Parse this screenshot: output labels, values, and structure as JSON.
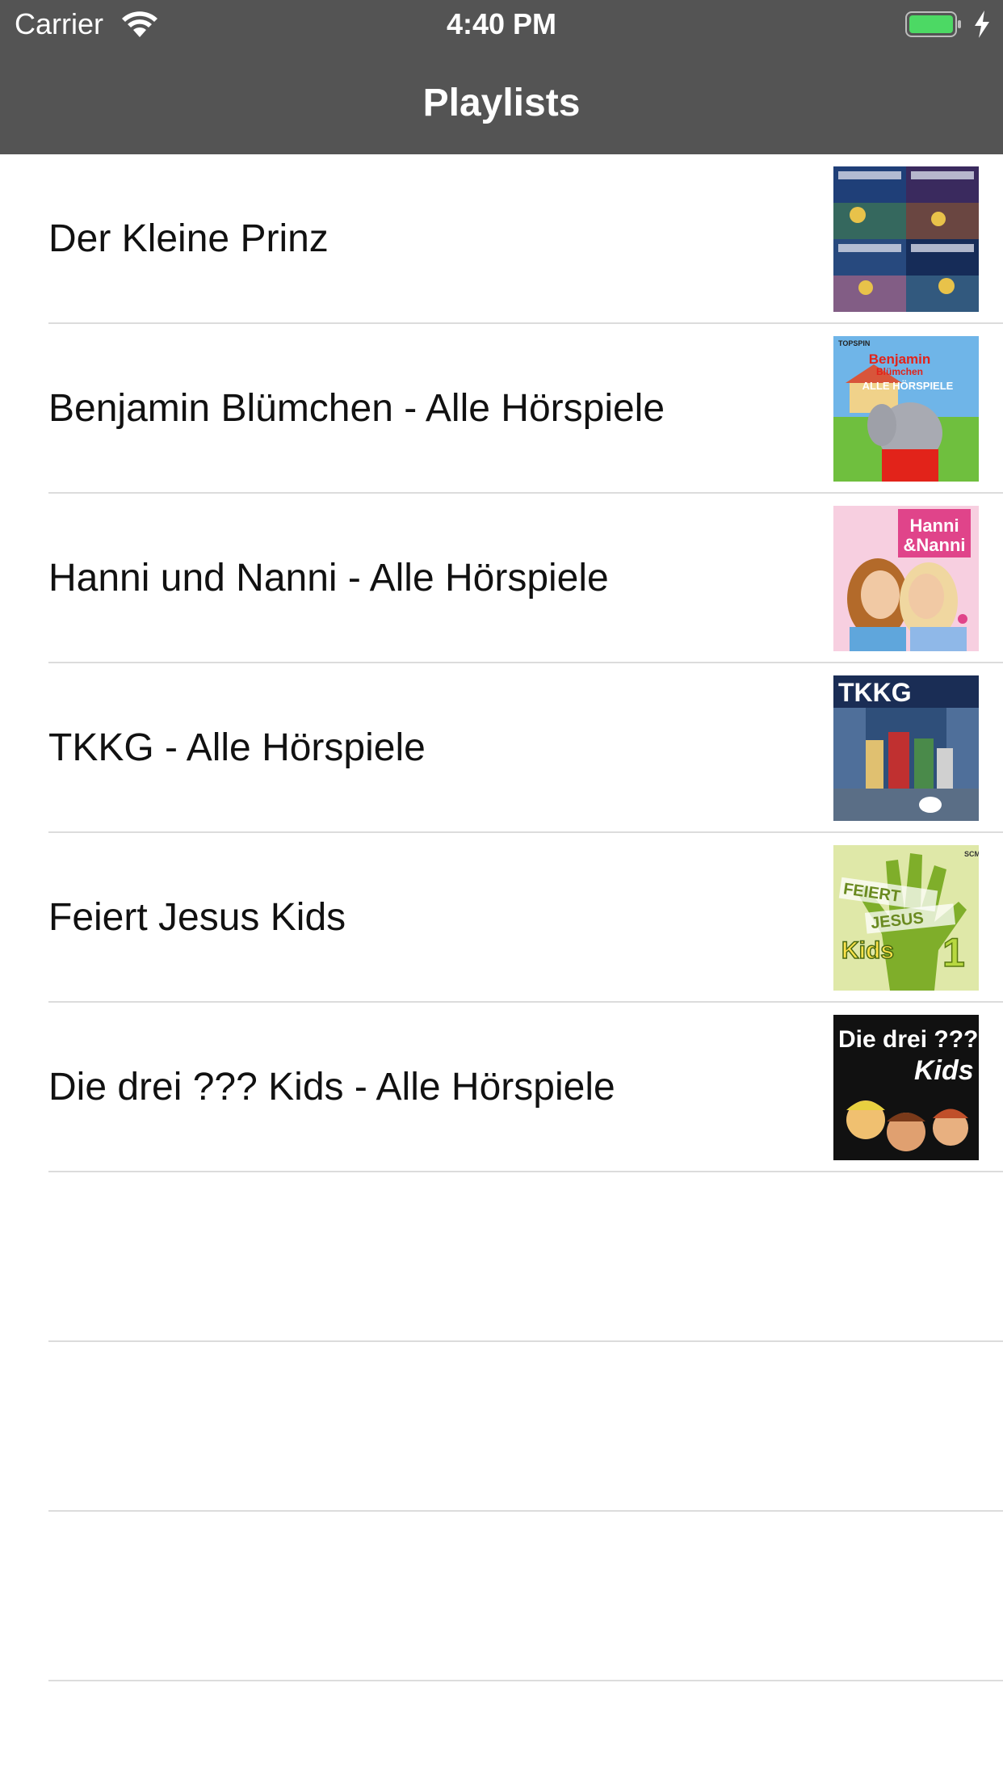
{
  "status": {
    "carrier": "Carrier",
    "time": "4:40 PM",
    "wifi_icon": "wifi-icon",
    "battery_icon": "battery-icon",
    "charging_icon": "charging-bolt-icon",
    "battery_color": "#4cd964"
  },
  "nav": {
    "title": "Playlists",
    "bar_color": "#545454"
  },
  "playlists": [
    {
      "title": "Der Kleine Prinz",
      "cover": "der-kleine-prinz-cover"
    },
    {
      "title": "Benjamin Blümchen - Alle Hörspiele",
      "cover": "benjamin-bluemchen-cover",
      "cover_text": [
        "TOPSPIN",
        "Benjamin",
        "Blümchen",
        "ALLE HÖRSPIELE"
      ]
    },
    {
      "title": "Hanni und Nanni - Alle Hörspiele",
      "cover": "hanni-und-nanni-cover",
      "cover_text": [
        "Hanni",
        "&Nanni"
      ]
    },
    {
      "title": "TKKG - Alle Hörspiele",
      "cover": "tkkg-cover",
      "cover_text": [
        "TKKG"
      ]
    },
    {
      "title": "Feiert Jesus Kids",
      "cover": "feiert-jesus-kids-cover",
      "cover_text": [
        "FEIERT",
        "JESUS",
        "Kids",
        "1",
        "SCM"
      ]
    },
    {
      "title": "Die drei ??? Kids - Alle Hörspiele",
      "cover": "die-drei-fragezeichen-kids-cover",
      "cover_text": [
        "Die drei ???",
        "Kids"
      ]
    }
  ]
}
